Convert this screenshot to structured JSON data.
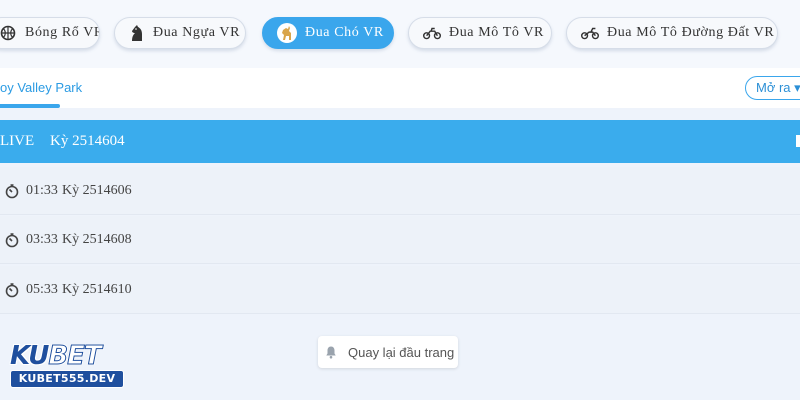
{
  "tabs": [
    {
      "label": "Bóng Rổ VR",
      "icon": "basketball-icon",
      "active": false
    },
    {
      "label": "Đua Ngựa VR",
      "icon": "horse-icon",
      "active": false
    },
    {
      "label": "Đua Chó VR",
      "icon": "dog-icon",
      "active": true
    },
    {
      "label": "Đua Mô Tô VR",
      "icon": "motorbike-icon",
      "active": false
    },
    {
      "label": "Đua Mô Tô Đường Đất VR",
      "icon": "dirt-bike-icon",
      "active": false
    }
  ],
  "venue": {
    "name": "oy Valley Park",
    "open_label": "Mở ra ▾"
  },
  "live_race": {
    "status": "LIVE",
    "code": "Kỳ 2514604"
  },
  "races": [
    {
      "time": "01:33",
      "code": "Kỳ 2514606"
    },
    {
      "time": "03:33",
      "code": "Kỳ 2514608"
    },
    {
      "time": "05:33",
      "code": "Kỳ 2514610"
    }
  ],
  "back_to_top": {
    "label": "Quay lại đầu trang"
  },
  "logo": {
    "brand_ku": "KU",
    "brand_bet": "BET",
    "domain": "KUBET555.DEV"
  },
  "colors": {
    "accent": "#3aa6ec",
    "brand": "#1f4f9e"
  }
}
